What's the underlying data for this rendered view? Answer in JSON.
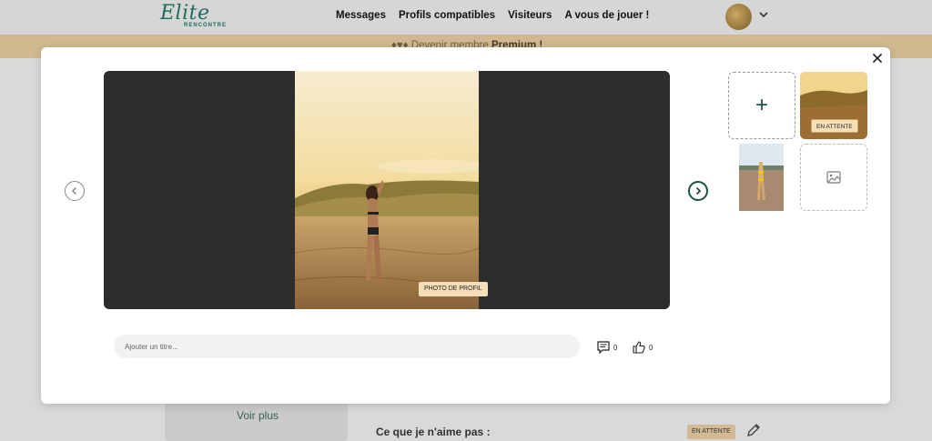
{
  "header": {
    "logo_main": "Elite",
    "logo_sub": "RENCONTRE",
    "nav": [
      "Messages",
      "Profils compatibles",
      "Visiteurs",
      "A vous de jouer !"
    ]
  },
  "banner": {
    "prefix": "Devenir membre",
    "highlight": "Premium !"
  },
  "background": {
    "voir_plus": "Voir plus",
    "dislike_label": "Ce que je n'aime pas :",
    "status_badge": "EN ATTENTE"
  },
  "modal": {
    "main_photo_badge": "PHOTO DE PROFIL",
    "thumbnails": [
      {
        "type": "add",
        "icon": "plus-icon"
      },
      {
        "type": "photo",
        "badge": "EN ATTENTE"
      },
      {
        "type": "photo"
      },
      {
        "type": "empty",
        "icon": "image-placeholder-icon"
      }
    ],
    "title_input": {
      "placeholder": "Ajouter un titre...",
      "value": ""
    },
    "comments_count": "0",
    "likes_count": "0"
  },
  "colors": {
    "brand": "#1f6b5c",
    "banner": "#e3c795",
    "badge": "#f6dfb8",
    "viewer_bg": "#2d2d2d"
  }
}
